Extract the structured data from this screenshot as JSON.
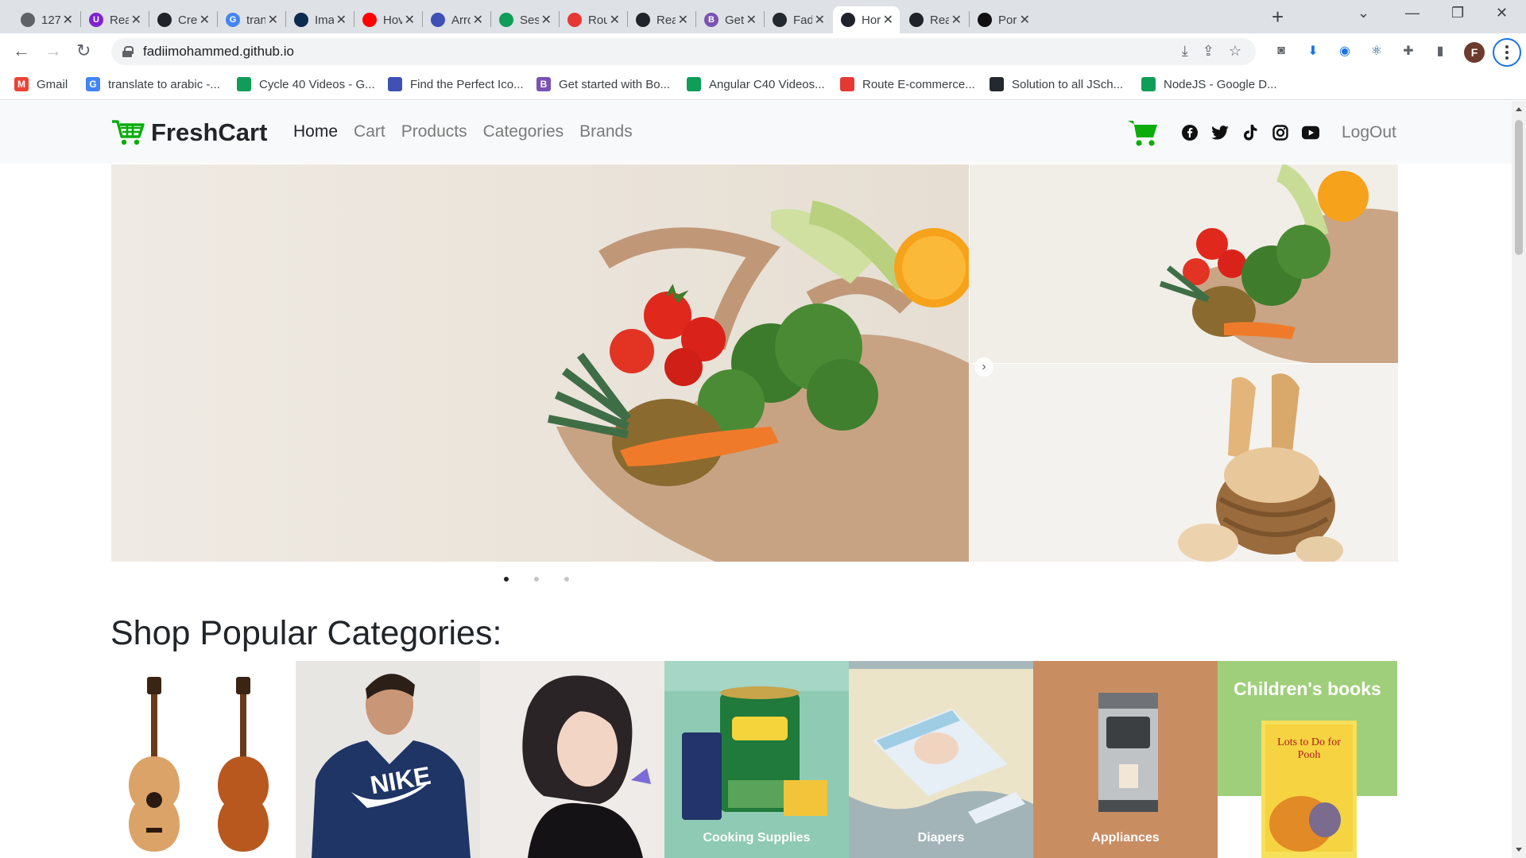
{
  "browser": {
    "tabs": [
      {
        "title": "127",
        "color": "#5f6368",
        "letter": ""
      },
      {
        "title": "Rea",
        "color": "#7e22ce",
        "letter": "U"
      },
      {
        "title": "Cre",
        "color": "#20232a",
        "letter": ""
      },
      {
        "title": "tran",
        "color": "#4285f4",
        "letter": "G"
      },
      {
        "title": "Ima",
        "color": "#0d2b4f",
        "letter": ""
      },
      {
        "title": "Hov",
        "color": "#ff0000",
        "letter": ""
      },
      {
        "title": "Arrc",
        "color": "#3f51b5",
        "letter": ""
      },
      {
        "title": "Ses",
        "color": "#0f9d58",
        "letter": ""
      },
      {
        "title": "Rou",
        "color": "#e53935",
        "letter": ""
      },
      {
        "title": "Rea",
        "color": "#20232a",
        "letter": ""
      },
      {
        "title": "Get",
        "color": "#7952b3",
        "letter": "B"
      },
      {
        "title": "Fadi",
        "color": "#24292f",
        "letter": ""
      },
      {
        "title": "Hor",
        "color": "#20232a",
        "letter": ""
      },
      {
        "title": "Rea",
        "color": "#20232a",
        "letter": ""
      },
      {
        "title": "Por",
        "color": "#111111",
        "letter": ""
      }
    ],
    "active_tab": 12,
    "url": "fadiimohammed.github.io",
    "profile_letter": "F",
    "bookmarks": [
      {
        "label": "Gmail",
        "color": "#ea4335",
        "letter": "M"
      },
      {
        "label": "translate to arabic -...",
        "color": "#4285f4",
        "letter": "G"
      },
      {
        "label": "Cycle 40 Videos - G...",
        "color": "#0f9d58",
        "letter": ""
      },
      {
        "label": "Find the Perfect Ico...",
        "color": "#3f51b5",
        "letter": ""
      },
      {
        "label": "Get started with Bo...",
        "color": "#7952b3",
        "letter": "B"
      },
      {
        "label": "Angular C40 Videos...",
        "color": "#0f9d58",
        "letter": ""
      },
      {
        "label": "Route E-commerce...",
        "color": "#e53935",
        "letter": ""
      },
      {
        "label": "Solution to all JSch...",
        "color": "#24292f",
        "letter": ""
      },
      {
        "label": "NodeJS - Google D...",
        "color": "#0f9d58",
        "letter": ""
      }
    ]
  },
  "site": {
    "brand": "FreshCart",
    "nav": [
      "Home",
      "Cart",
      "Products",
      "Categories",
      "Brands"
    ],
    "active_nav": 0,
    "logout": "LogOut",
    "accent": "#0aad0a"
  },
  "slider": {
    "active_dot": 0,
    "dot_count": 3
  },
  "categories_section": {
    "title": "Shop Popular Categories:",
    "items": [
      {
        "name": "music-category",
        "label": ""
      },
      {
        "name": "mens-fashion-category",
        "label": ""
      },
      {
        "name": "womens-fashion-category",
        "label": ""
      },
      {
        "name": "supermarket-category",
        "label": "Cooking Supplies"
      },
      {
        "name": "baby-category",
        "label": "Diapers"
      },
      {
        "name": "home-category",
        "label": "Appliances"
      },
      {
        "name": "books-category",
        "label": "Children's books"
      }
    ],
    "book_title": "Lots to Do for Pooh"
  }
}
